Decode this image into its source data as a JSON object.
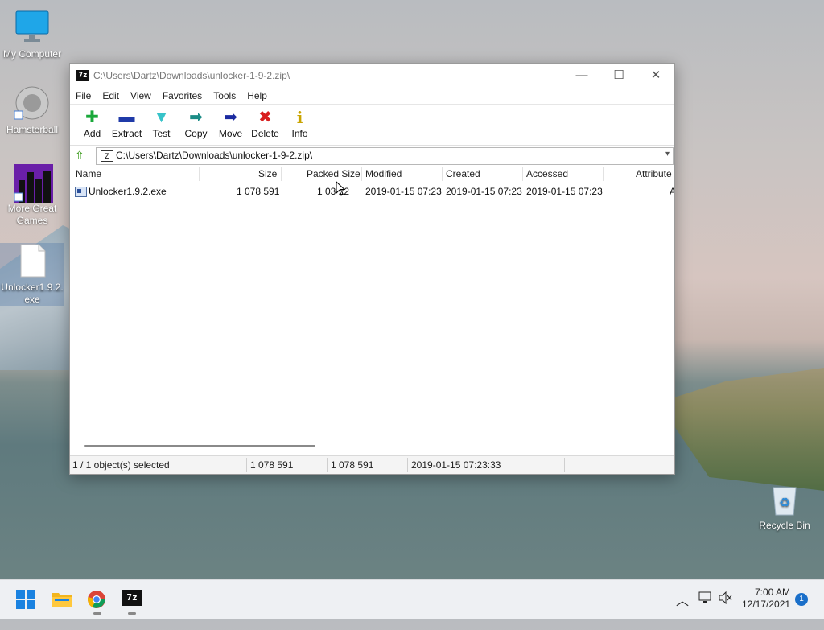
{
  "desktop": {
    "icons": [
      {
        "label": "My Computer"
      },
      {
        "label": "Hamsterball"
      },
      {
        "label": "More Great Games"
      },
      {
        "label": "Unlocker1.9.2.exe"
      },
      {
        "label": "Recycle Bin"
      }
    ]
  },
  "window": {
    "app_icon": "7z",
    "title": "C:\\Users\\Dartz\\Downloads\\unlocker-1-9-2.zip\\",
    "menu": [
      "File",
      "Edit",
      "View",
      "Favorites",
      "Tools",
      "Help"
    ],
    "toolbar": [
      {
        "label": "Add",
        "icon": "plus-icon",
        "glyph": "✚",
        "color": "#19a83a"
      },
      {
        "label": "Extract",
        "icon": "minus-icon",
        "glyph": "▬",
        "color": "#1f3aa8"
      },
      {
        "label": "Test",
        "icon": "check-down-icon",
        "glyph": "▼",
        "color": "#37c3c9"
      },
      {
        "label": "Copy",
        "icon": "arrow-right-icon",
        "glyph": "➡",
        "color": "#1b8c86"
      },
      {
        "label": "Move",
        "icon": "arrow-right-icon",
        "glyph": "➡",
        "color": "#1b2aa0"
      },
      {
        "label": "Delete",
        "icon": "cross-icon",
        "glyph": "✖",
        "color": "#d81e1e"
      },
      {
        "label": "Info",
        "icon": "info-icon",
        "glyph": "i",
        "color": "#c9a400"
      }
    ],
    "address": "C:\\Users\\Dartz\\Downloads\\unlocker-1-9-2.zip\\",
    "columns": [
      "Name",
      "Size",
      "Packed Size",
      "Modified",
      "Created",
      "Accessed",
      "Attribute"
    ],
    "rows": [
      {
        "name": "Unlocker1.9.2.exe",
        "size": "1 078 591",
        "packed_size": "1 03  22",
        "modified": "2019-01-15 07:23",
        "created": "2019-01-15 07:23",
        "accessed": "2019-01-15 07:23",
        "attribute": "A"
      }
    ],
    "status": {
      "selected": "1 / 1 object(s) selected",
      "size": "1 078 591",
      "packed": "1 078 591",
      "date": "2019-01-15 07:23:33"
    }
  },
  "taskbar": {
    "time": "7:00 AM",
    "date": "12/17/2021",
    "notification_count": "1",
    "app_7z_label": "7z"
  }
}
